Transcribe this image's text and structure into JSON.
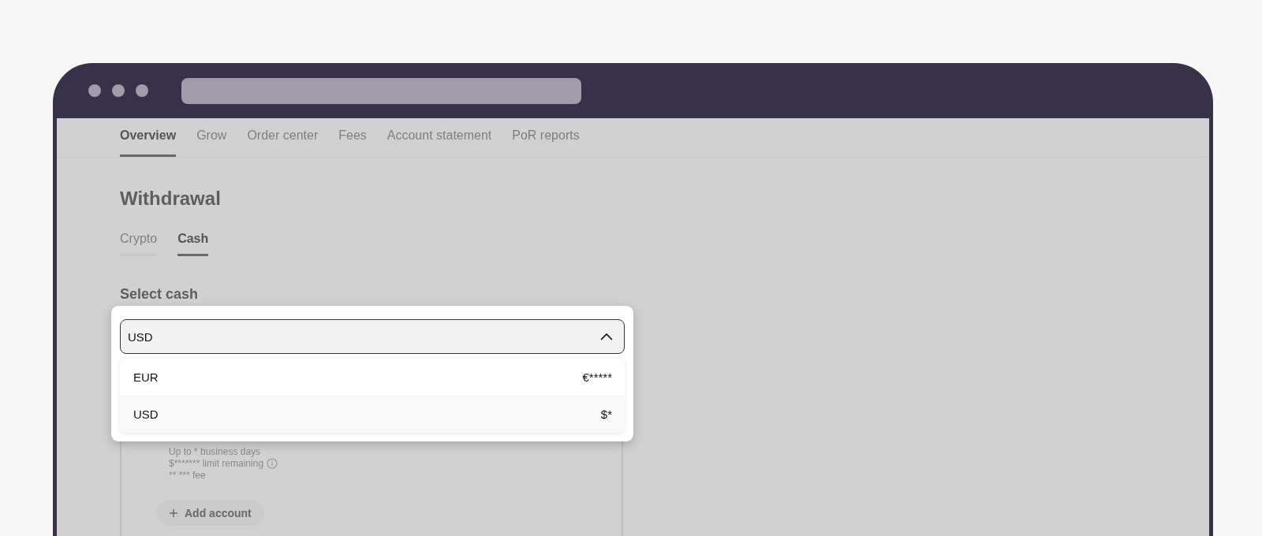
{
  "nav_tabs": [
    {
      "label": "Overview",
      "selected": true
    },
    {
      "label": "Grow",
      "selected": false
    },
    {
      "label": "Order center",
      "selected": false
    },
    {
      "label": "Fees",
      "selected": false
    },
    {
      "label": "Account statement",
      "selected": false
    },
    {
      "label": "PoR reports",
      "selected": false
    }
  ],
  "page_title": "Withdrawal",
  "method_tabs": [
    {
      "label": "Crypto",
      "selected": false
    },
    {
      "label": "Cash",
      "selected": true
    }
  ],
  "section_label": "Select cash",
  "select": {
    "value": "USD",
    "expanded": true
  },
  "options": [
    {
      "label": "EUR",
      "amount": "€*****",
      "selected": false
    },
    {
      "label": "USD",
      "amount": "$*",
      "selected": true
    }
  ],
  "account_card": {
    "lines": [
      "Up to * business days",
      "$******* limit remaining",
      "** *** fee"
    ],
    "add_button": "Add account"
  }
}
